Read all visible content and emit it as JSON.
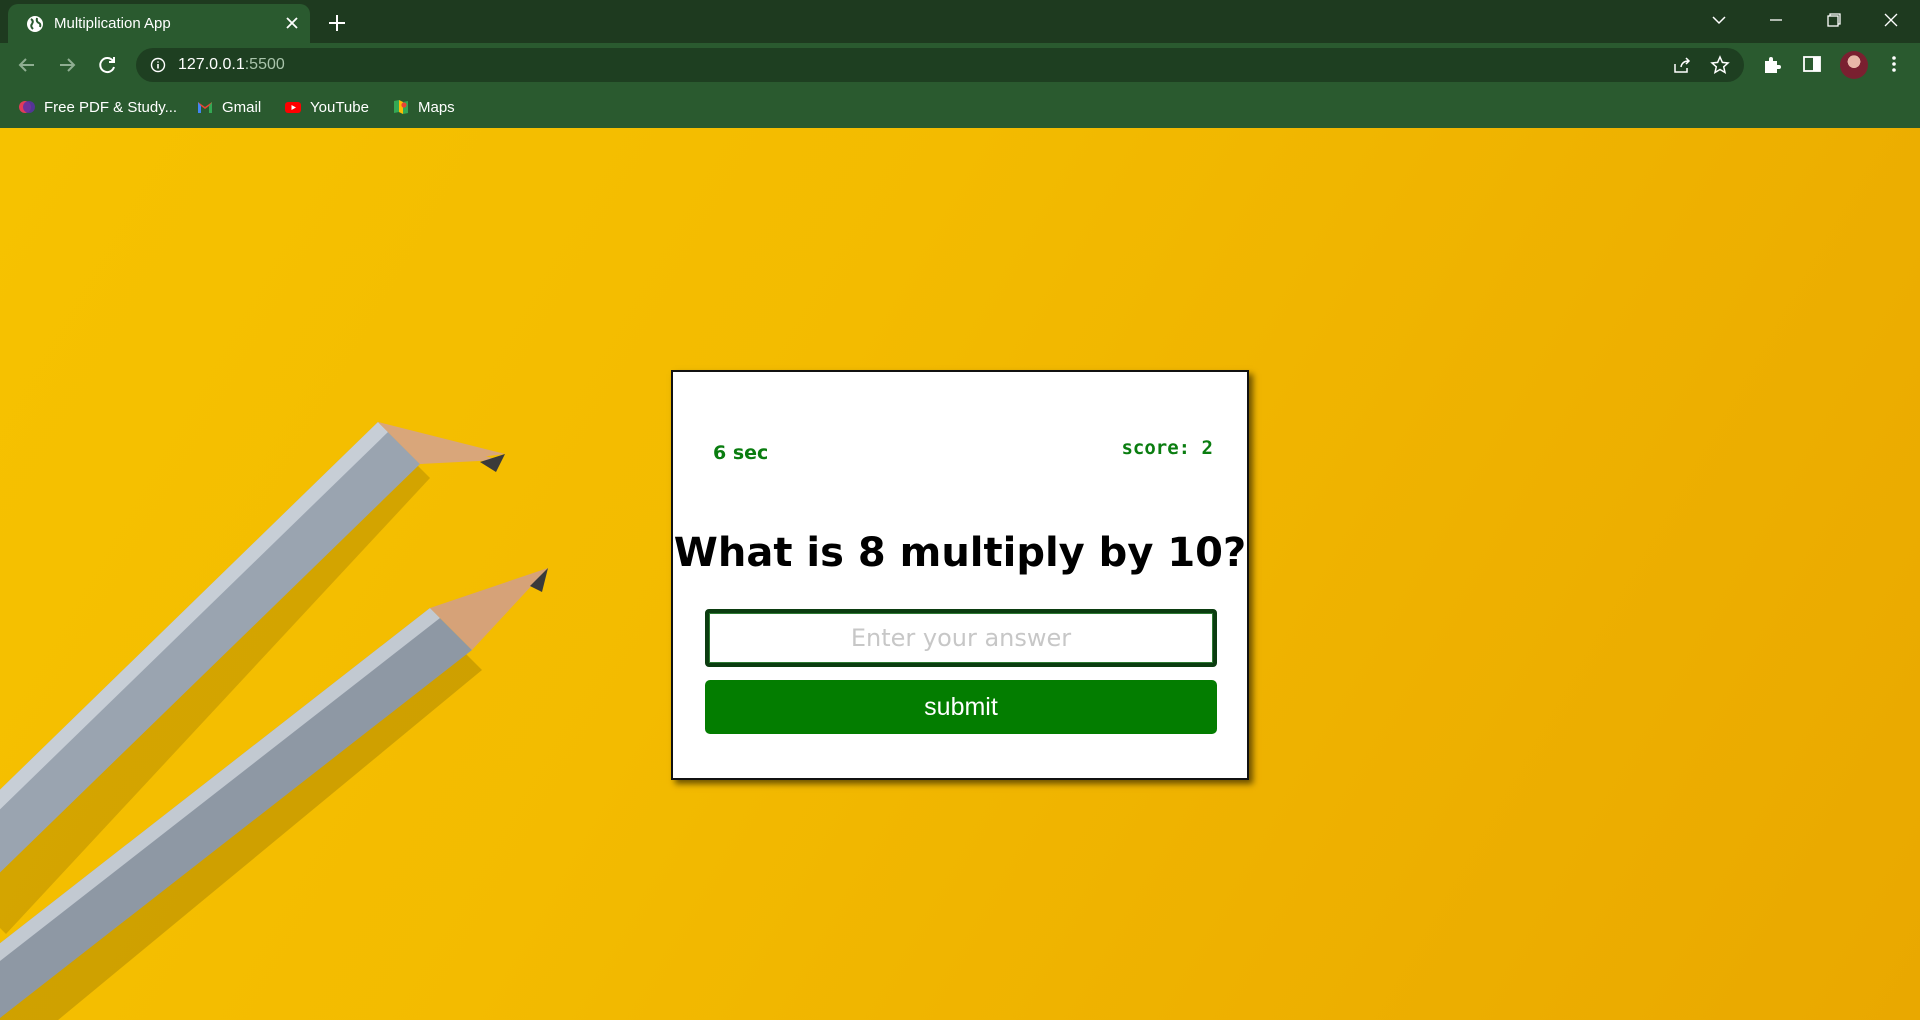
{
  "browser": {
    "tab_title": "Multiplication App",
    "url_host": "127.0.0.1",
    "url_port": ":5500",
    "bookmarks": [
      {
        "label": "Free PDF & Study...",
        "icon": "pdf-site-icon"
      },
      {
        "label": "Gmail",
        "icon": "gmail-icon"
      },
      {
        "label": "YouTube",
        "icon": "youtube-icon"
      },
      {
        "label": "Maps",
        "icon": "maps-icon"
      }
    ],
    "colors": {
      "frame": "#1e3a1f",
      "toolbar": "#2a5a2f"
    }
  },
  "game": {
    "timer_text": "6 sec",
    "score_text": "score: 2",
    "question": "What is 8 multiply by 10?",
    "answer_placeholder": "Enter your answer",
    "answer_value": "",
    "submit_label": "submit",
    "colors": {
      "accent": "#037d00",
      "background": "#f3bb00"
    }
  }
}
